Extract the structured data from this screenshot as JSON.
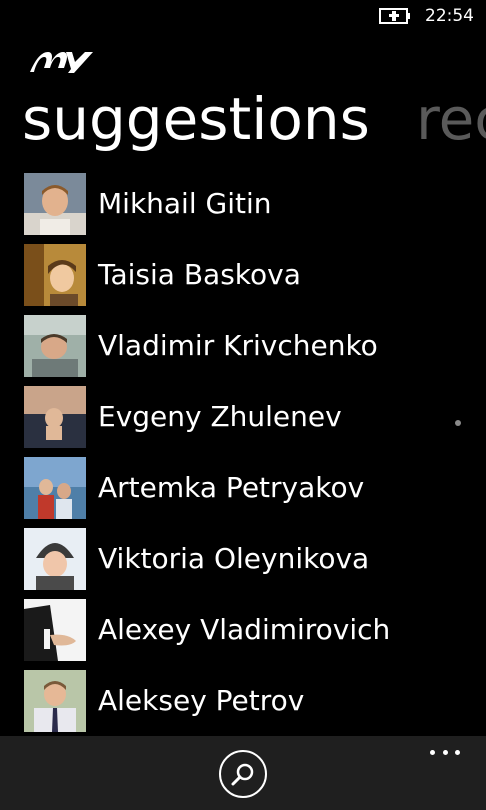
{
  "status": {
    "time": "22:54",
    "battery_icon": "battery-charging-icon"
  },
  "app": {
    "logo_text": "MY"
  },
  "pivot": {
    "current": "suggestions",
    "next": "rec"
  },
  "suggestions": [
    {
      "name": "Mikhail Gitin",
      "avatar_icon": "avatar-photo"
    },
    {
      "name": "Taisia Baskova",
      "avatar_icon": "avatar-photo"
    },
    {
      "name": "Vladimir Krivchenko",
      "avatar_icon": "avatar-photo"
    },
    {
      "name": "Evgeny Zhulenev",
      "avatar_icon": "avatar-photo",
      "online_indicator": true
    },
    {
      "name": "Artemka Petryakov",
      "avatar_icon": "avatar-photo"
    },
    {
      "name": "Viktoria Oleynikova",
      "avatar_icon": "avatar-photo"
    },
    {
      "name": "Alexey Vladimirovich",
      "avatar_icon": "avatar-photo"
    },
    {
      "name": "Aleksey Petrov",
      "avatar_icon": "avatar-photo"
    }
  ],
  "app_bar": {
    "search_icon": "search-icon",
    "more_icon": "more-dots-icon"
  },
  "colors": {
    "background": "#000000",
    "app_bar": "#1f1f1f",
    "pivot_inactive": "#5a5a5a",
    "text": "#ffffff"
  }
}
